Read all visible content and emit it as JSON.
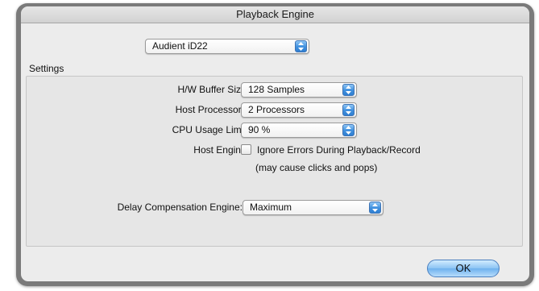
{
  "window": {
    "title": "Playback Engine"
  },
  "device_popup": {
    "value": "Audient iD22"
  },
  "settings": {
    "section_label": "Settings",
    "hw_buffer_size": {
      "label": "H/W Buffer Size:",
      "value": "128 Samples"
    },
    "host_processors": {
      "label": "Host Processors:",
      "value": "2 Processors"
    },
    "cpu_usage_limit": {
      "label": "CPU Usage Limit:",
      "value": "90 %"
    },
    "host_engine": {
      "label": "Host Engine:",
      "checkbox_label": "Ignore Errors During Playback/Record",
      "checked": false,
      "note": "(may cause clicks and pops)"
    },
    "delay_compensation": {
      "label": "Delay Compensation Engine:",
      "value": "Maximum"
    }
  },
  "buttons": {
    "ok": "OK"
  },
  "colors": {
    "accent": "#3f8fde",
    "window_frame": "#7a7a7a",
    "panel": "#ececec"
  }
}
